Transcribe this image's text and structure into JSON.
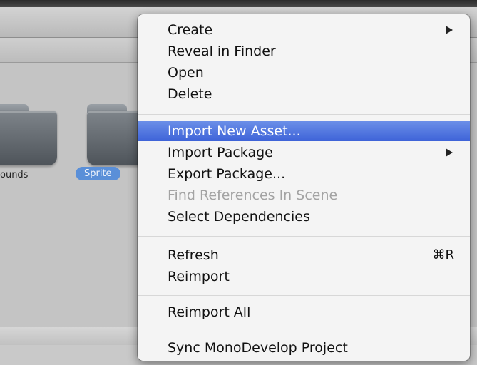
{
  "project_panel": {
    "folders": [
      {
        "label": "ounds"
      },
      {
        "label": "Sprite"
      }
    ]
  },
  "context_menu": {
    "items": [
      {
        "label": "Create",
        "submenu": true
      },
      {
        "label": "Reveal in Finder"
      },
      {
        "label": "Open"
      },
      {
        "label": "Delete"
      },
      {
        "label": "Import New Asset...",
        "highlighted": true
      },
      {
        "label": "Import Package",
        "submenu": true
      },
      {
        "label": "Export Package..."
      },
      {
        "label": "Find References In Scene",
        "disabled": true
      },
      {
        "label": "Select Dependencies"
      },
      {
        "label": "Refresh",
        "shortcut": "⌘R"
      },
      {
        "label": "Reimport"
      },
      {
        "label": "Reimport All"
      },
      {
        "label": "Sync MonoDevelop Project"
      }
    ]
  },
  "colors": {
    "highlight": "#4a6fe0",
    "selected_label": "#5a8fd8"
  }
}
